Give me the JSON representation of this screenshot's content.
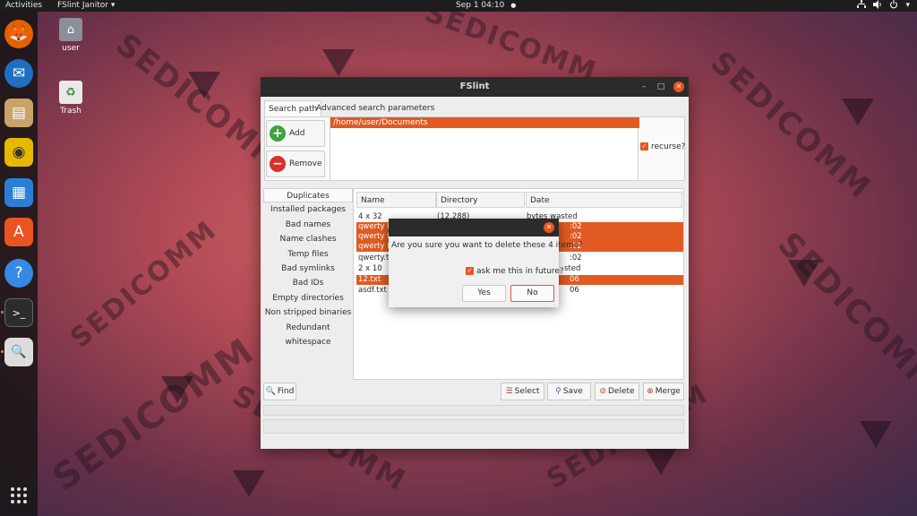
{
  "topbar": {
    "activities": "Activities",
    "app_menu": "FSlint Janitor",
    "app_menu_arrow": "▾",
    "clock": "Sep 1  04:10",
    "clock_dot": "●",
    "network_icon": "network-icon",
    "volume_icon": "volume-icon",
    "power_icon": "power-icon",
    "menu_arrow": "▾"
  },
  "dock": {
    "items": [
      {
        "icon": "firefox-icon",
        "glyph": "🦊",
        "bg": "#e66000"
      },
      {
        "icon": "thunderbird-icon",
        "glyph": "✉",
        "bg": "#1f6fc2"
      },
      {
        "icon": "files-icon",
        "glyph": "▤",
        "bg": "#c9a36a"
      },
      {
        "icon": "rhythmbox-icon",
        "glyph": "◉",
        "bg": "#e6b800"
      },
      {
        "icon": "writer-icon",
        "glyph": "▦",
        "bg": "#2a7fd4"
      },
      {
        "icon": "software-icon",
        "glyph": "A",
        "bg": "#e95420"
      },
      {
        "icon": "help-icon",
        "glyph": "?",
        "bg": "#3689e6"
      },
      {
        "icon": "terminal-icon",
        "glyph": ">_",
        "bg": "#2c2c2c"
      },
      {
        "icon": "fslint-icon",
        "glyph": "🔍",
        "bg": "#dcdcdc"
      }
    ],
    "apps_grid_icon": "apps-grid-icon"
  },
  "desktop": {
    "icons": [
      {
        "icon": "home-folder-icon",
        "label": "user"
      },
      {
        "icon": "trash-icon",
        "label": "Trash"
      }
    ]
  },
  "watermark": "SEDICOMM",
  "window": {
    "title": "FSlint",
    "minimize": "–",
    "maximize": "□",
    "close": "✕",
    "tabs": [
      "Search path",
      "Advanced search parameters"
    ],
    "path": "/home/user/Documents",
    "add_label": "Add",
    "remove_label": "Remove",
    "recurse_label": "recurse?",
    "sidebar": [
      "Duplicates",
      "Installed packages",
      "Bad names",
      "Name clashes",
      "Temp files",
      "Bad symlinks",
      "Bad IDs",
      "Empty directories",
      "Non stripped binaries",
      "Redundant whitespace"
    ],
    "columns": [
      "Name",
      "Directory",
      "Date"
    ],
    "rows": [
      {
        "name": "4 x 32",
        "dir": "(12,288)",
        "date": "bytes wasted",
        "sel": false
      },
      {
        "name": "qwerty (",
        "dir": "",
        "date": ":02",
        "sel": true
      },
      {
        "name": "qwerty (",
        "dir": "",
        "date": ":02",
        "sel": true
      },
      {
        "name": "qwerty (",
        "dir": "",
        "date": ":02",
        "sel": true
      },
      {
        "name": "qwerty.t",
        "dir": "",
        "date": ":02",
        "sel": false
      },
      {
        "name": "2 x 10",
        "dir": "",
        "date": "sted",
        "sel": false
      },
      {
        "name": "12.txt",
        "dir": "",
        "date": "06",
        "sel": true
      },
      {
        "name": "asdf.txt",
        "dir": "",
        "date": "06",
        "sel": false
      }
    ],
    "buttons": {
      "find": "Find",
      "select": "Select",
      "save": "Save",
      "delete": "Delete",
      "merge": "Merge"
    }
  },
  "dialog": {
    "message": "Are you sure you want to delete these 4 items?",
    "ask_label": "ask me this in future?",
    "yes": "Yes",
    "no": "No",
    "close": "✕"
  },
  "colors": {
    "accent": "#e05a22",
    "titlebar": "#2b2b2b",
    "close_button": "#e95420"
  }
}
